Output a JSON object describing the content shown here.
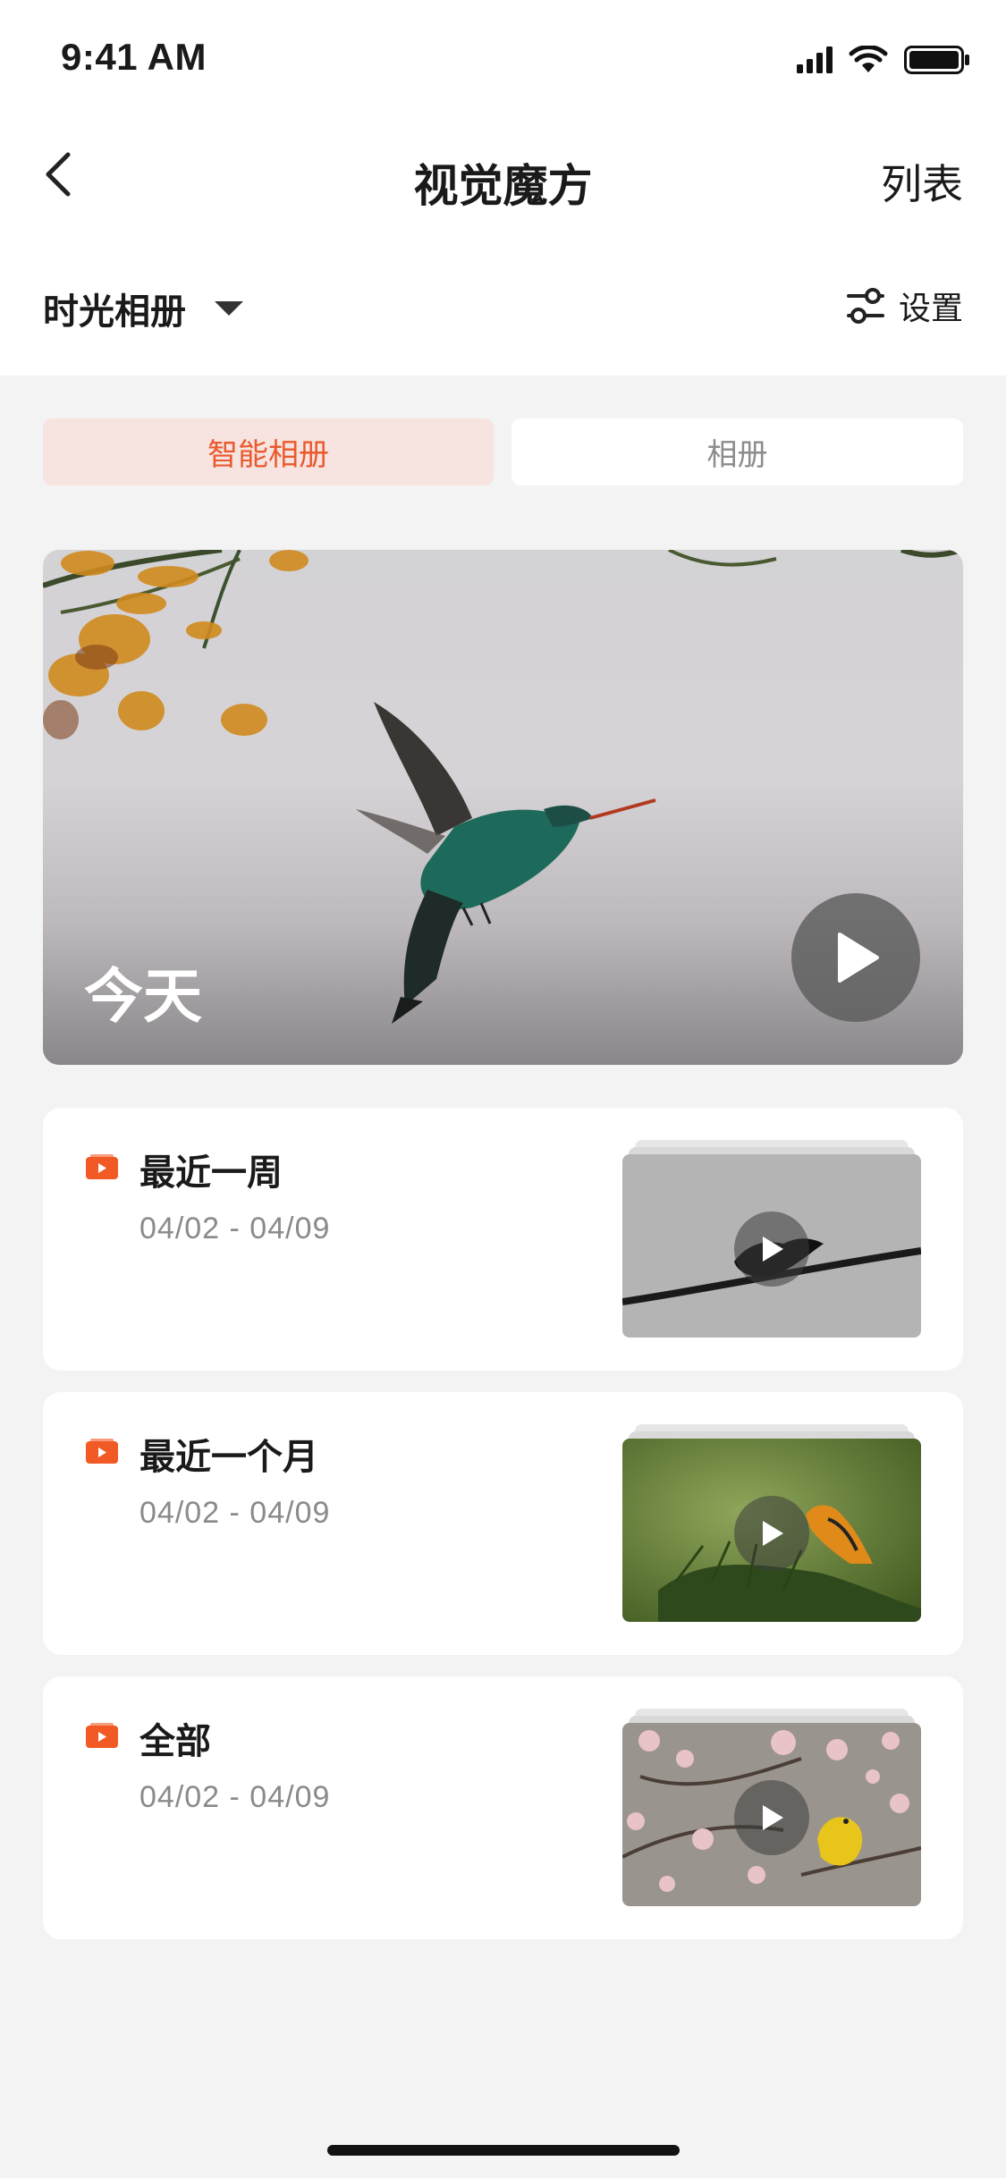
{
  "status_bar": {
    "time": "9:41 AM"
  },
  "nav": {
    "title": "视觉魔方",
    "right_label": "列表"
  },
  "toolbar": {
    "album_selector": "时光相册",
    "settings_label": "设置"
  },
  "tabs": [
    {
      "label": "智能相册",
      "active": true
    },
    {
      "label": "相册",
      "active": false
    }
  ],
  "hero": {
    "label": "今天"
  },
  "albums": [
    {
      "title": "最近一周",
      "date": "04/02 - 04/09"
    },
    {
      "title": "最近一个月",
      "date": "04/02 - 04/09"
    },
    {
      "title": "全部",
      "date": "04/02 - 04/09"
    }
  ],
  "colors": {
    "accent": "#ea5a2e",
    "tab_active_bg": "#f7e3df",
    "page_bg": "#f3f3f3"
  }
}
